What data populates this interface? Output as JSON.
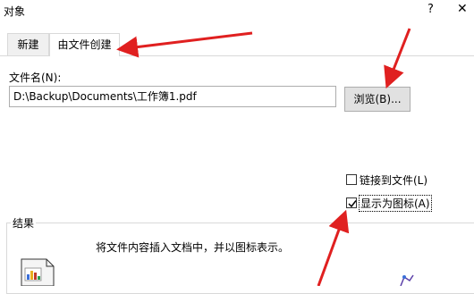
{
  "window": {
    "title": "对象",
    "help_glyph": "?",
    "close_glyph": "✕"
  },
  "tabs": [
    {
      "label": "新建",
      "active": false
    },
    {
      "label": "由文件创建",
      "active": true
    }
  ],
  "file": {
    "label": "文件名(N):",
    "value": "D:\\Backup\\Documents\\工作簿1.pdf",
    "browse_label": "浏览(B)..."
  },
  "options": {
    "link_label": "链接到文件(L)",
    "link_checked": false,
    "display_icon_label": "显示为图标(A)",
    "display_icon_checked": true
  },
  "result": {
    "label": "结果",
    "text": "将文件内容插入文档中，并以图标表示。"
  },
  "colors": {
    "arrow": "#e02020",
    "border": "#adadad",
    "tab_border": "#d9d9d9"
  }
}
